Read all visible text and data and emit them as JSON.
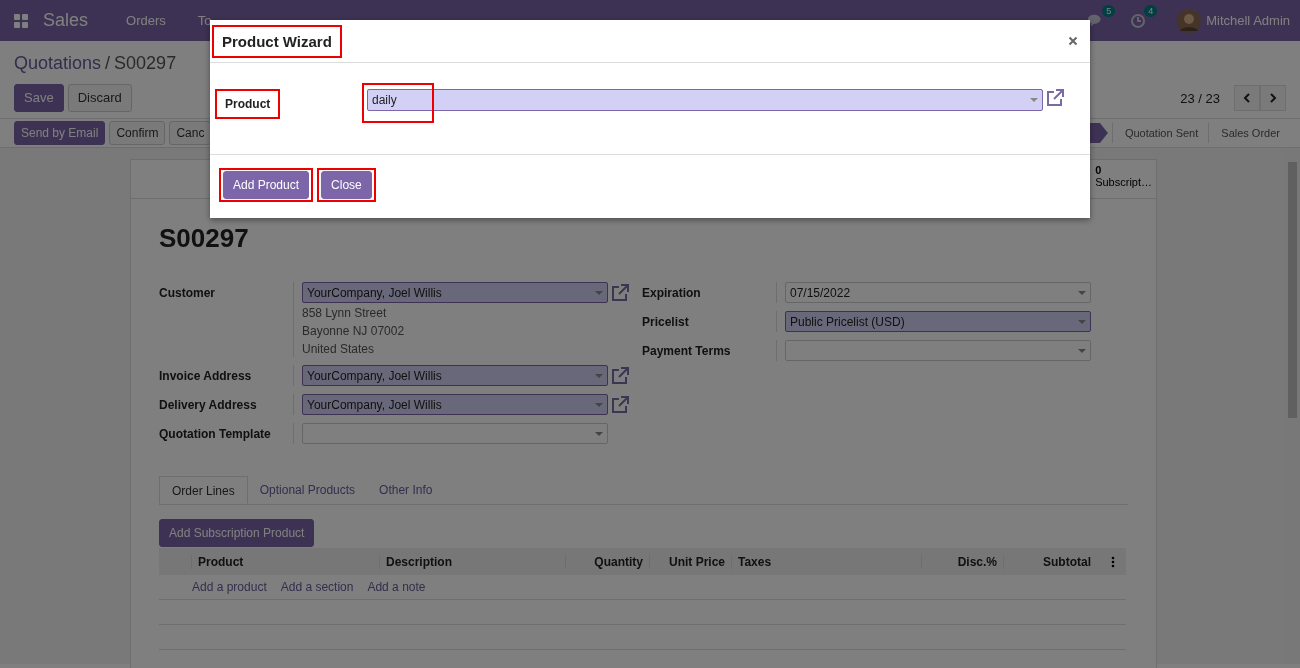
{
  "navbar": {
    "app_name": "Sales",
    "menu": [
      "Orders",
      "To"
    ],
    "messages_count": "5",
    "activities_count": "4",
    "user": "Mitchell Admin"
  },
  "breadcrumb": {
    "parent": "Quotations",
    "separator": "/",
    "current": "S00297"
  },
  "form_buttons": [
    "Save",
    "Discard"
  ],
  "pager": "23 / 23",
  "action_buttons": [
    {
      "label": "Send by Email",
      "kind": "primary"
    },
    {
      "label": "Confirm",
      "kind": "secondary"
    },
    {
      "label": "Canc",
      "kind": "secondary"
    }
  ],
  "status_stages": [
    {
      "selected": true
    },
    {
      "label": "Quotation Sent",
      "selected": false
    },
    {
      "label": "Sales Order",
      "selected": false
    }
  ],
  "smart_button": {
    "value": "0",
    "label": "Subscript…"
  },
  "record_name": "S00297",
  "left_fields": [
    {
      "label": "Customer",
      "value": "YourCompany, Joel Willis",
      "kind": "many2one",
      "address": [
        "858 Lynn Street",
        "Bayonne NJ 07002",
        "United States"
      ]
    },
    {
      "label": "Invoice Address",
      "value": "YourCompany, Joel Willis",
      "kind": "many2one"
    },
    {
      "label": "Delivery Address",
      "value": "YourCompany, Joel Willis",
      "kind": "many2one"
    },
    {
      "label": "Quotation Template",
      "kind": "select"
    }
  ],
  "right_fields": [
    {
      "label": "Expiration",
      "value": "07/15/2022",
      "kind": "select"
    },
    {
      "label": "Pricelist",
      "value": "Public Pricelist (USD)",
      "kind": "many2one"
    },
    {
      "label": "Payment Terms",
      "kind": "select"
    }
  ],
  "tabs": [
    {
      "label": "Order Lines",
      "selected": true
    },
    {
      "label": "Optional Products",
      "selected": false
    },
    {
      "label": "Other Info",
      "selected": false
    }
  ],
  "add_subscription_button": "Add Subscription Product",
  "table": {
    "columns": [
      "Product",
      "Description",
      "Quantity",
      "Unit Price",
      "Taxes",
      "Disc.%",
      "Subtotal"
    ],
    "add_links": [
      "Add a product",
      "Add a section",
      "Add a note"
    ]
  },
  "modal": {
    "title": "Product Wizard",
    "field_label": "Product",
    "field_value": "daily",
    "buttons": [
      "Add Product",
      "Close"
    ]
  }
}
